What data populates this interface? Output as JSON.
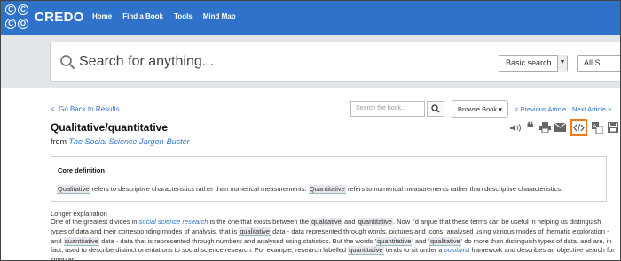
{
  "brand": {
    "name": "CREDO",
    "logo_letters": [
      "C",
      "C",
      "C",
      "O"
    ]
  },
  "nav": [
    "Home",
    "Find a Book",
    "Tools",
    "Mind Map"
  ],
  "search": {
    "placeholder": "Search for anything...",
    "type": "Basic search",
    "scope": "All S"
  },
  "toolbar": {
    "back": "Go Back to Results",
    "book_search_placeholder": "Search the book...",
    "browse": "Browse Book",
    "prev": "Previous Article",
    "next": "Next Article"
  },
  "article": {
    "title": "Qualitative/quantitative",
    "from_label": "from",
    "source": "The Social Science Jargon-Buster"
  },
  "tools": [
    "speaker-icon",
    "quote-icon",
    "print-icon",
    "email-icon",
    "embed-icon",
    "translate-icon",
    "save-icon"
  ],
  "core": {
    "heading": "Core definition",
    "w1": "Qualitative",
    "t1": " refers to descriptive characteristics rather than numerical measurements. ",
    "w2": "Quantitative",
    "t2": " refers to numerical measurements rather than descriptive characteristics."
  },
  "long": {
    "heading": "Longer explanation",
    "a1": "One of the greatest divides in ",
    "link1": "social science research",
    "a2": " is the one that exists between the ",
    "h1": "qualitative",
    "a3": " and ",
    "h2": "quantitative",
    "a4": ". Now I'd argue that these terms can be useful in helping us distinguish types of data and their corresponding modes of analysis, that is ",
    "h3": "qualitative",
    "a5": " data - data represented through words, pictures and icons, analysed using various modes of thematic exploration - and ",
    "h4": "quantitative",
    "a6": " data - data that is represented through numbers and analysed using statistics. But the words '",
    "h5": "quantitative",
    "a7": "' and '",
    "h6": "qualitative",
    "a8": "' do more than distinguish types of data, and are, in fact, used to describe distinct orientations to social science research. For example, research labelled ",
    "h7": "quantitative",
    "a9": " tends to sit under a ",
    "link2": "positivist",
    "a10": " framework and describes an objective search for singular"
  }
}
